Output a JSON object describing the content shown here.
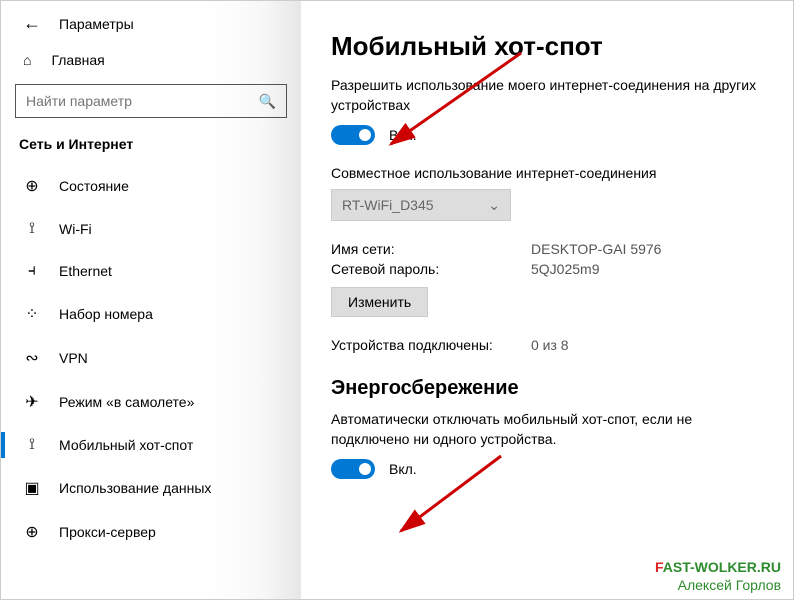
{
  "header": {
    "title": "Параметры"
  },
  "sidebar": {
    "home_label": "Главная",
    "search_placeholder": "Найти параметр",
    "category": "Сеть и Интернет",
    "items": [
      {
        "label": "Состояние",
        "icon": "⊕"
      },
      {
        "label": "Wi-Fi",
        "icon": "⟟"
      },
      {
        "label": "Ethernet",
        "icon": "⫞"
      },
      {
        "label": "Набор номера",
        "icon": "⁘"
      },
      {
        "label": "VPN",
        "icon": "∾"
      },
      {
        "label": "Режим «в самолете»",
        "icon": "✈"
      },
      {
        "label": "Мобильный хот-спот",
        "icon": "⟟"
      },
      {
        "label": "Использование данных",
        "icon": "▣"
      },
      {
        "label": "Прокси-сервер",
        "icon": "⊕"
      }
    ],
    "active_index": 6
  },
  "main": {
    "title": "Мобильный хот-спот",
    "share_descr": "Разрешить использование моего интернет-соединения на других устройствах",
    "toggle1_label": "Вкл.",
    "channel_label": "Совместное использование интернет-соединения",
    "channel_value": "RT-WiFi_D345",
    "name_key": "Имя сети:",
    "name_val": "DESKTOP-GAI 5976",
    "pw_key": "Сетевой пароль:",
    "pw_val": "5QJ025m9",
    "edit_label": "Изменить",
    "conn_key": "Устройства подключены:",
    "conn_val": "0 из 8",
    "energy_title": "Энергосбережение",
    "energy_descr": "Автоматически отключать мобильный хот-спот, если не подключено ни одного устройства.",
    "toggle2_label": "Вкл."
  },
  "watermark": {
    "line1a": "F",
    "line1b": "A",
    "line1c": "ST-WOLKER.RU",
    "line2": "Алексей Горлов"
  }
}
